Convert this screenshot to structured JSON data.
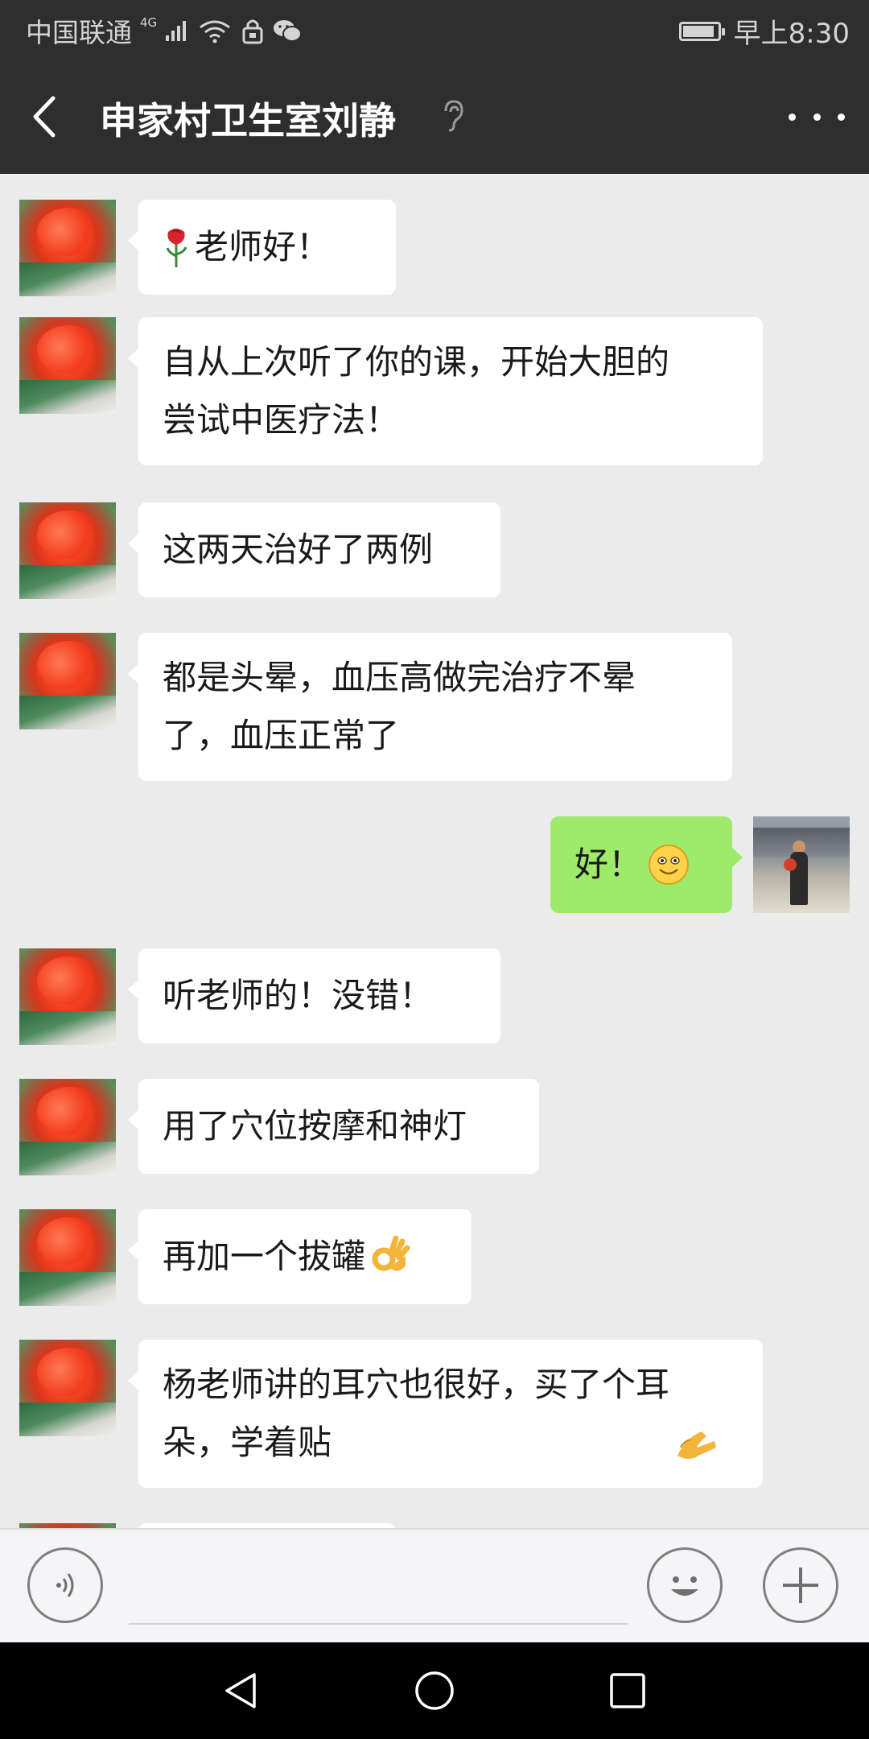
{
  "status_bar": {
    "carrier": "中国联通",
    "network": "4G",
    "time": "早上8:30",
    "battery_level": 0.9,
    "icons": [
      "signal-icon",
      "wifi-icon",
      "lock-icon",
      "wechat-icon",
      "battery-icon"
    ]
  },
  "header": {
    "title": "申家村卫生室刘静",
    "back_icon": "chevron-left-icon",
    "mute_icon": "ear-icon",
    "more_icon": "more-dots-icon"
  },
  "messages": [
    {
      "side": "left",
      "emoji_before": "rose-emoji",
      "text": "老师好！"
    },
    {
      "side": "left",
      "text": "自从上次听了你的课，开始大胆的\n尝试中医疗法！"
    },
    {
      "side": "left",
      "text": "这两天治好了两例"
    },
    {
      "side": "left",
      "text": "都是头晕，血压高做完治疗不晕\n了，血压正常了"
    },
    {
      "side": "right",
      "text": "好！",
      "emoji_after": "smile-emoji"
    },
    {
      "side": "left",
      "text": "听老师的！没错！"
    },
    {
      "side": "left",
      "text": "用了穴位按摩和神灯"
    },
    {
      "side": "left",
      "text": "再加一个拔罐",
      "emoji_after": "ok-hand-emoji"
    },
    {
      "side": "left",
      "text": "杨老师讲的耳穴也很好，买了个耳\n朵，学着贴",
      "emoji_after": "clapping-hand-emoji"
    }
  ],
  "input_bar": {
    "voice_icon": "voice-icon",
    "emoji_icon": "emoji-face-icon",
    "plus_icon": "plus-icon"
  },
  "nav_bar": {
    "back_icon": "nav-back-icon",
    "home_icon": "nav-home-icon",
    "recents_icon": "nav-recents-icon"
  },
  "colors": {
    "bar": "#2e2e2e",
    "chat_bg": "#ebebeb",
    "bubble_in": "#ffffff",
    "bubble_out": "#9eea6a"
  }
}
